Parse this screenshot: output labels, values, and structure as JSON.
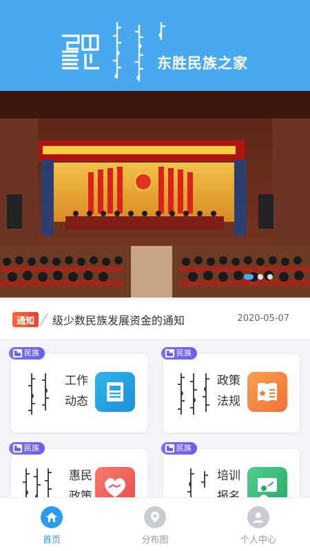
{
  "header": {
    "app_title": "东胜民族之家",
    "bg_color": "#49a9ee"
  },
  "banner": {
    "slide_count": 3,
    "active_slide": 1
  },
  "notice": {
    "tag": "通知",
    "text": "级少数民族发展资金的通知",
    "date": "2020-05-07"
  },
  "cards": [
    {
      "badge": "民族",
      "title_line1": "工作",
      "title_line2": "动态",
      "icon": "newspaper-icon",
      "icon_color": "#1fa8e8"
    },
    {
      "badge": "民族",
      "title_line1": "政策",
      "title_line2": "法规",
      "icon": "book-star-icon",
      "icon_color": "#f3883f"
    },
    {
      "badge": "民族",
      "title_line1": "惠民",
      "title_line2": "政策",
      "icon": "handshake-icon",
      "icon_color": "#f2645c"
    },
    {
      "badge": "民族",
      "title_line1": "培训",
      "title_line2": "报名",
      "icon": "presentation-board-icon",
      "icon_color": "#3dbb7a"
    }
  ],
  "tabbar": {
    "items": [
      {
        "label": "首页",
        "icon": "home-icon",
        "active": true
      },
      {
        "label": "分布图",
        "icon": "map-icon",
        "active": false
      },
      {
        "label": "个人中心",
        "icon": "user-icon",
        "active": false
      }
    ],
    "active_color": "#2d9cf0"
  }
}
